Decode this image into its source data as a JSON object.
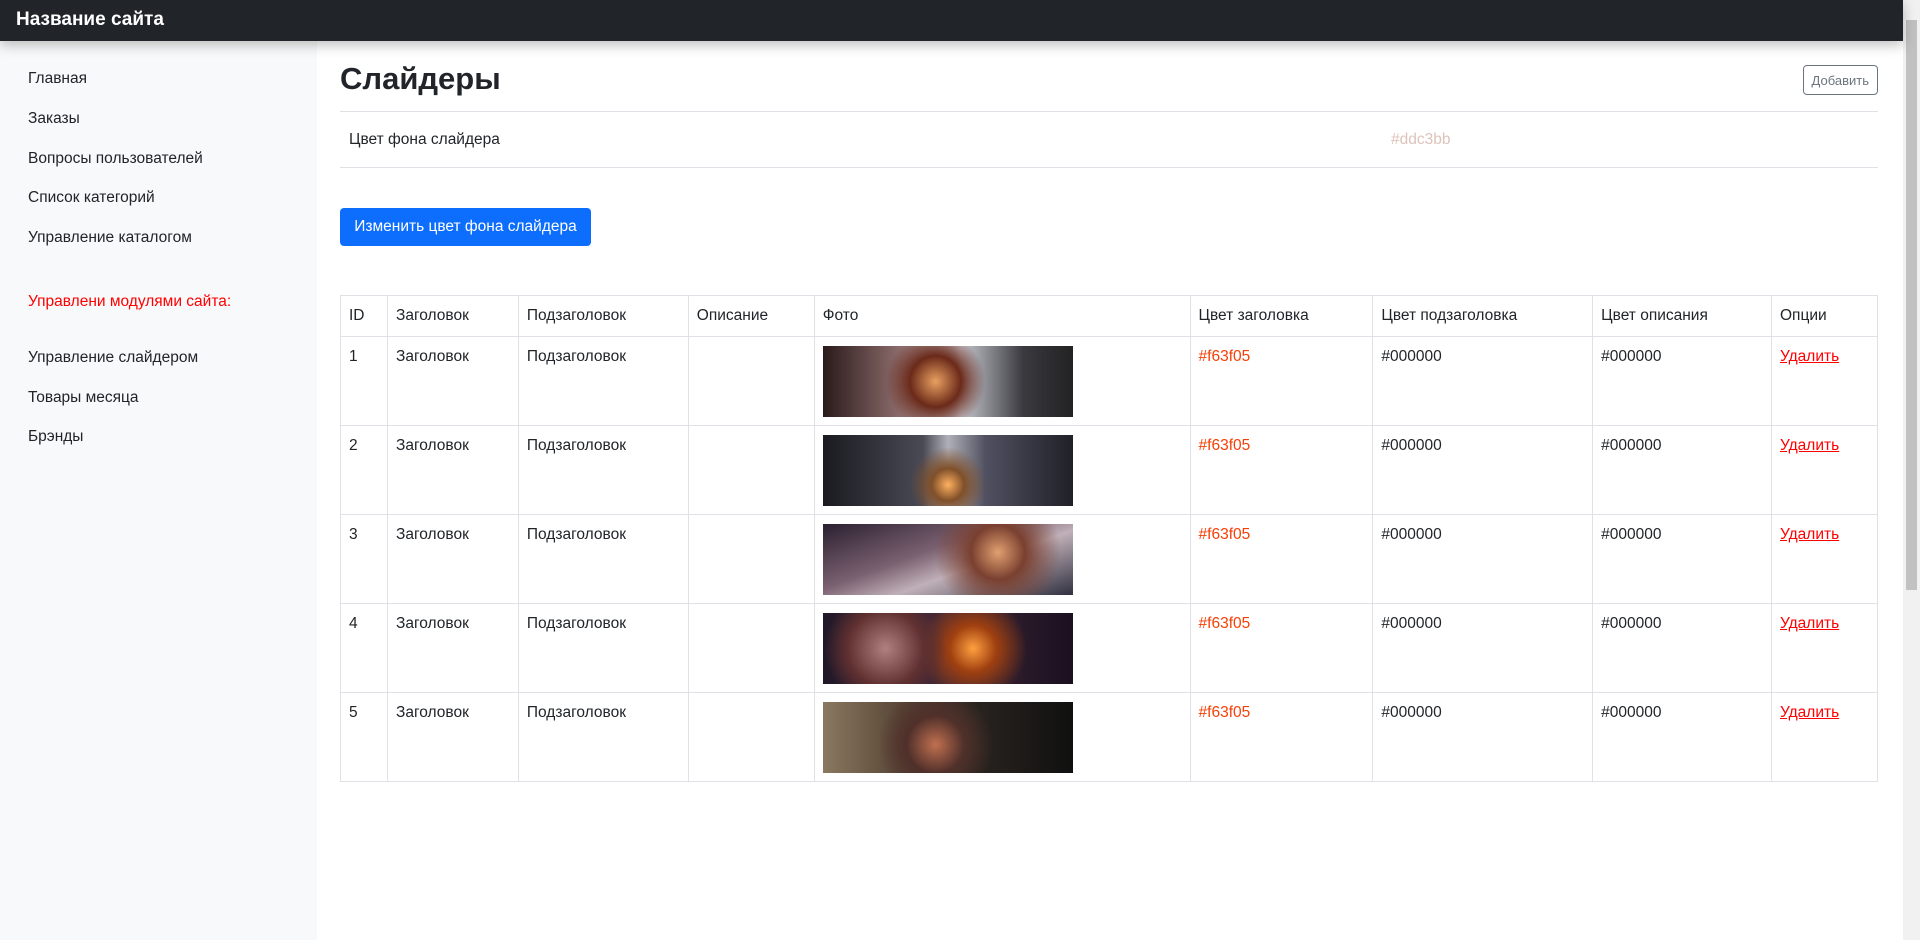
{
  "header": {
    "brand": "Название сайта"
  },
  "sidebar": {
    "items": [
      "Главная",
      "Заказы",
      "Вопросы пользователей",
      "Список категорий",
      "Управление каталогом"
    ],
    "section_heading": "Управлени модулями сайта:",
    "module_items": [
      "Управление слайдером",
      "Товары месяца",
      "Брэнды"
    ]
  },
  "main": {
    "title": "Слайдеры",
    "add_label": "Добавить",
    "bg_color_label": "Цвет фона слайдера",
    "bg_color_value": "#ddc3bb",
    "change_bg_label": "Изменить цвет фона слайдера",
    "table": {
      "headers": [
        "ID",
        "Заголовок",
        "Подзаголовок",
        "Описание",
        "Фото",
        "Цвет заголовка",
        "Цвет подзаголовка",
        "Цвет описания",
        "Опции"
      ],
      "rows": [
        {
          "id": "1",
          "title": "Заголовок",
          "subtitle": "Подзаголовок",
          "description": "",
          "title_color": "#f63f05",
          "subtitle_color": "#000000",
          "desc_color": "#000000",
          "action": "Удалить"
        },
        {
          "id": "2",
          "title": "Заголовок",
          "subtitle": "Подзаголовок",
          "description": "",
          "title_color": "#f63f05",
          "subtitle_color": "#000000",
          "desc_color": "#000000",
          "action": "Удалить"
        },
        {
          "id": "3",
          "title": "Заголовок",
          "subtitle": "Подзаголовок",
          "description": "",
          "title_color": "#f63f05",
          "subtitle_color": "#000000",
          "desc_color": "#000000",
          "action": "Удалить"
        },
        {
          "id": "4",
          "title": "Заголовок",
          "subtitle": "Подзаголовок",
          "description": "",
          "title_color": "#f63f05",
          "subtitle_color": "#000000",
          "desc_color": "#000000",
          "action": "Удалить"
        },
        {
          "id": "5",
          "title": "Заголовок",
          "subtitle": "Подзаголовок",
          "description": "",
          "title_color": "#f63f05",
          "subtitle_color": "#000000",
          "desc_color": "#000000",
          "action": "Удалить"
        }
      ]
    }
  }
}
